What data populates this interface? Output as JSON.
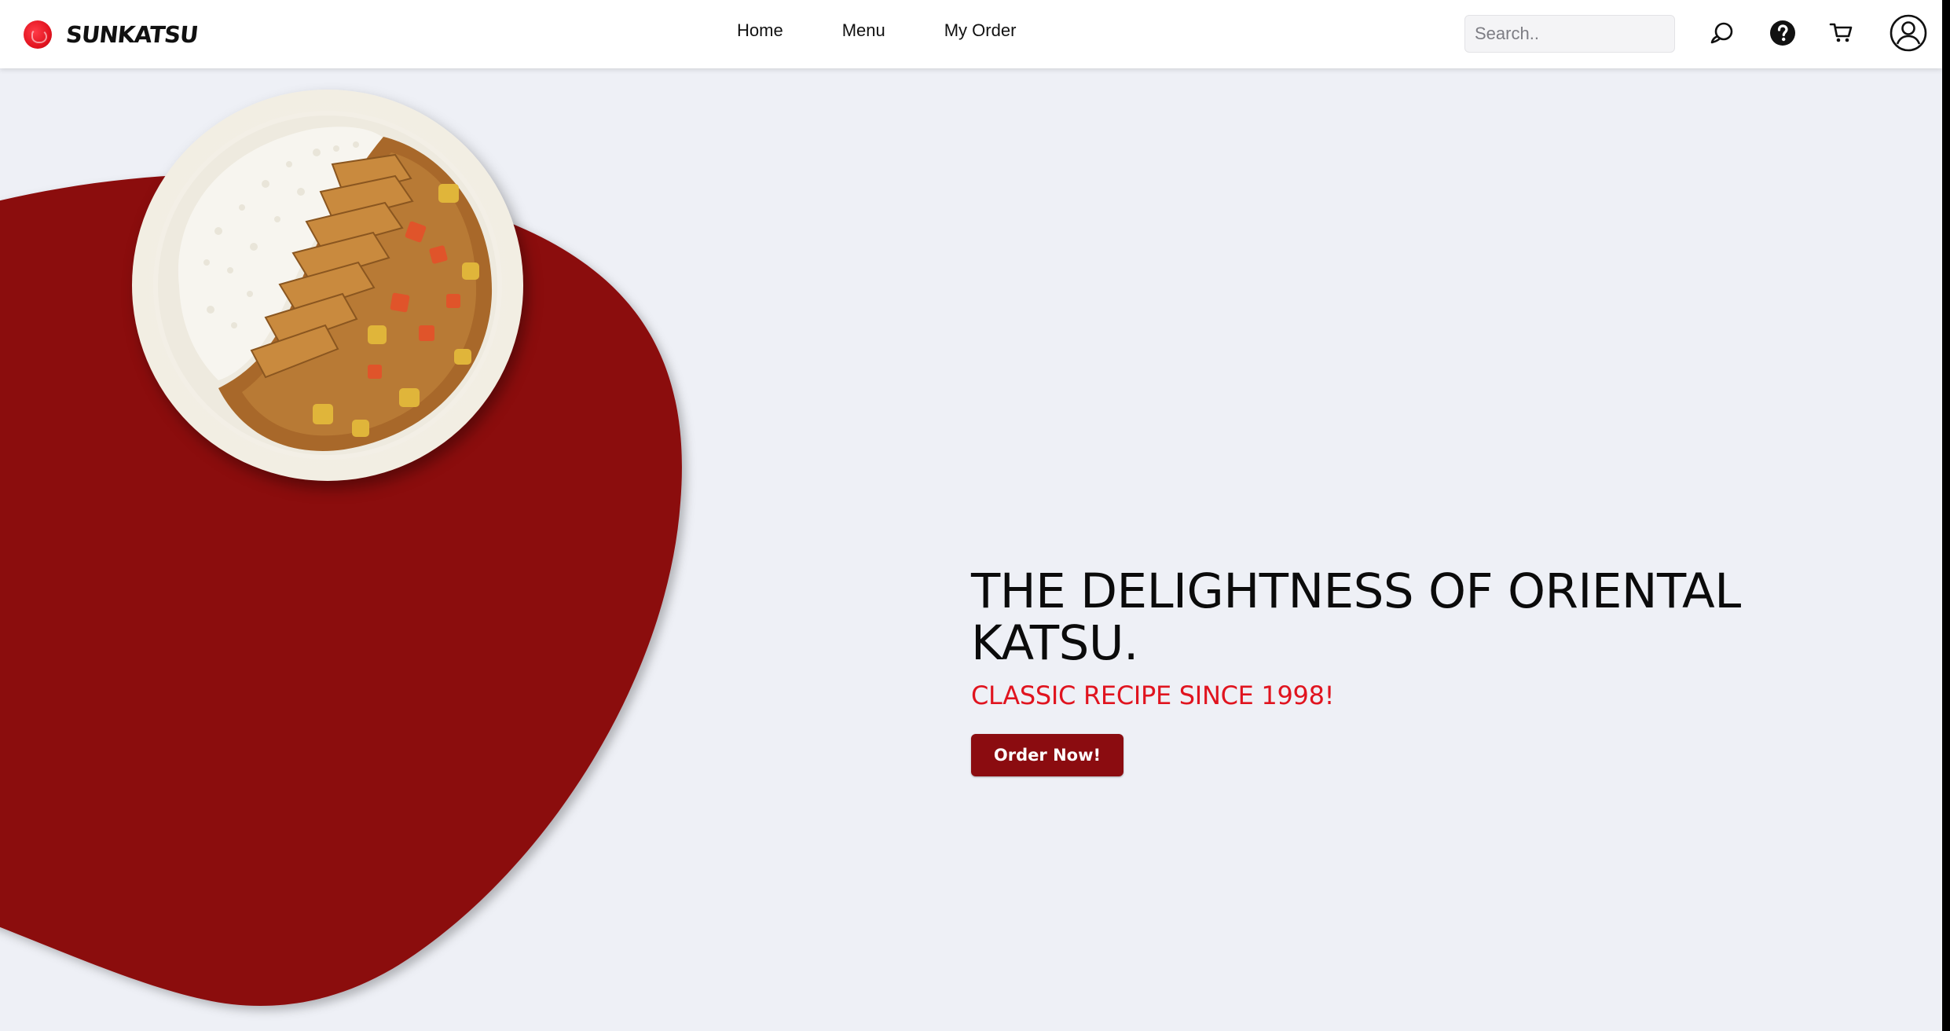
{
  "brand": {
    "name": "SUNKATSU",
    "logo_icon": "sun-logo-icon"
  },
  "nav": {
    "links": [
      "Home",
      "Menu",
      "My Order"
    ]
  },
  "search": {
    "placeholder": "Search..",
    "value": ""
  },
  "toolbar_icons": [
    "chat-icon",
    "help-icon",
    "cart-icon",
    "user-account-icon"
  ],
  "hero": {
    "title": "THE DELIGHTNESS OF ORIENTAL KATSU.",
    "subtitle": "CLASSIC RECIPE SINCE 1998!",
    "cta_label": "Order Now!",
    "image": "katsu-curry-plate-image"
  },
  "colors": {
    "accent_red": "#e0141f",
    "dark_red": "#8b0c10",
    "background": "#eef0f6"
  }
}
